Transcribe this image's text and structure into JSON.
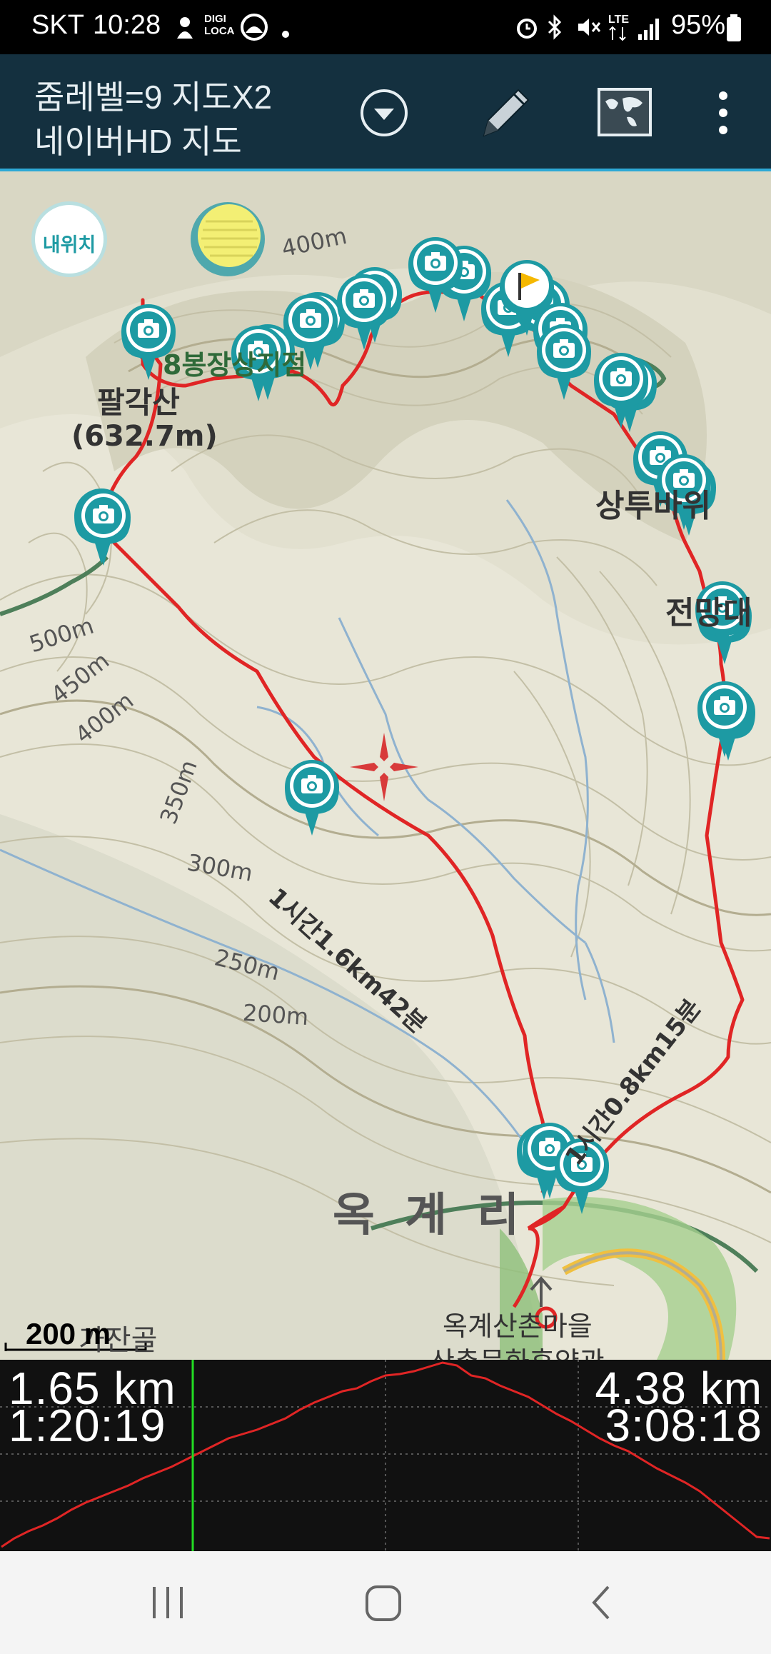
{
  "status_bar": {
    "carrier": "SKT",
    "time": "10:28",
    "app_badge": "DIGI\nLOCA",
    "battery": "95%"
  },
  "toolbar": {
    "zoom_line": "줌레벨=9 지도X2",
    "map_source": "네이버HD 지도",
    "icons": [
      "dropdown-circle-icon",
      "pencil-icon",
      "world-map-icon",
      "more-vert-icon"
    ]
  },
  "map": {
    "my_location_label": "내위치",
    "place_labels": {
      "peak": "팔각산",
      "peak_elev": "(632.7m)",
      "start_point": "8봉장상지점",
      "rock1": "상투바위",
      "rock2": "전망대",
      "village": "옥 계 리",
      "park_1": "옥계산촌마을",
      "park_2": "산촌문화휴양관",
      "valley": "가잔골"
    },
    "contours": [
      "500m",
      "450m",
      "400m",
      "350m",
      "300m",
      "250m",
      "200m",
      "400m"
    ],
    "trail_labels": [
      "1시간1.6km42분",
      "1시간0.8km15분"
    ],
    "scale_label": "200 m",
    "track_color": "#e02525",
    "marker_color": "#1d9aa3",
    "flag_color": "#f5b800"
  },
  "elevation": {
    "left_distance": "1.65 km",
    "left_time": "1:20:19",
    "right_distance": "4.38 km",
    "right_time": "3:08:18",
    "cursor_fraction": 0.377,
    "line_color": "#e02525",
    "cursor_color": "#22dd22"
  },
  "navbar": {
    "icons": [
      "recent-apps-icon",
      "home-icon",
      "back-icon"
    ]
  }
}
